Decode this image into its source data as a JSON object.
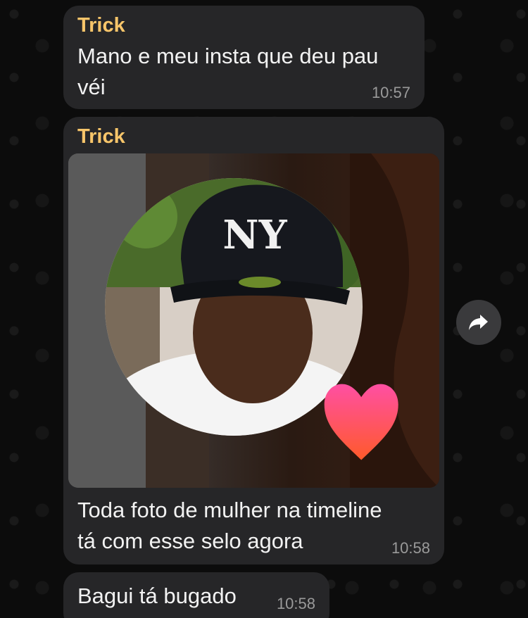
{
  "messages": [
    {
      "sender": "Trick",
      "text_line1": "Mano e meu insta que deu pau",
      "text_line2": "véi",
      "time": "10:57"
    },
    {
      "sender": "Trick",
      "has_image": true,
      "cap_logo": "NY",
      "caption_line1": "Toda foto de mulher na timeline",
      "caption_line2": "tá com esse selo agora",
      "time": "10:58"
    },
    {
      "text": "Bagui tá bugado",
      "time": "10:58"
    }
  ],
  "icons": {
    "forward": "forward-arrow-icon",
    "badge": "heart-icon"
  },
  "colors": {
    "sender": "#f7c56a",
    "bubble": "#262628",
    "background": "#0b0b0b",
    "heart_top": "#ff4fa3",
    "heart_bottom": "#ff5a2a"
  }
}
